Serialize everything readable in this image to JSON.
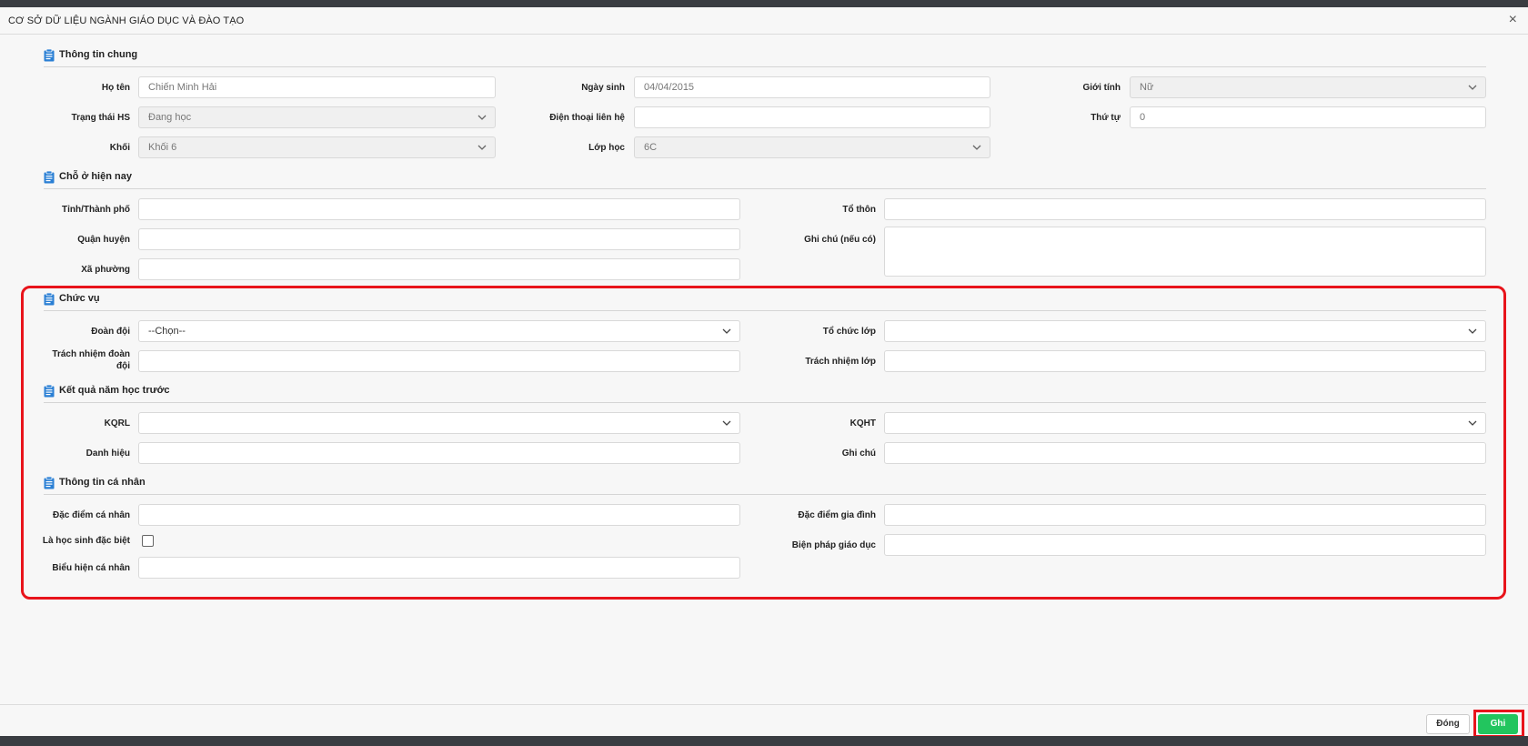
{
  "dialog": {
    "title": "CƠ SỞ DỮ LIỆU NGÀNH GIÁO DỤC VÀ ĐÀO TẠO",
    "close_glyph": "×"
  },
  "sections": {
    "general": "Thông tin chung",
    "residence": "Chỗ ở hiện nay",
    "position": "Chức vụ",
    "prev_result": "Kết quả năm học trước",
    "personal": "Thông tin cá nhân"
  },
  "general": {
    "name_label": "Họ tên",
    "name_value": "Chiến Minh Hải",
    "dob_label": "Ngày sinh",
    "dob_value": "04/04/2015",
    "gender_label": "Giới tính",
    "gender_value": "Nữ",
    "status_label": "Trạng thái HS",
    "status_value": "Đang học",
    "phone_label": "Điện thoại liên hệ",
    "phone_value": "",
    "order_label": "Thứ tự",
    "order_value": "0",
    "grade_label": "Khối",
    "grade_value": "Khối 6",
    "class_label": "Lớp học",
    "class_value": "6C"
  },
  "residence": {
    "province_label": "Tỉnh/Thành phố",
    "hamlet_label": "Tổ thôn",
    "district_label": "Quận huyện",
    "note_label": "Ghi chú (nếu có)",
    "ward_label": "Xã phường"
  },
  "position": {
    "union_label": "Đoàn đội",
    "union_value": "--Chọn--",
    "class_org_label": "Tổ chức lớp",
    "class_org_value": "",
    "union_duty_label_1": "Trách nhiệm đoàn",
    "union_duty_label_2": "đội",
    "class_duty_label": "Trách nhiệm lớp"
  },
  "prev_result": {
    "kqrl_label": "KQRL",
    "kqht_label": "KQHT",
    "title_label": "Danh hiệu",
    "note_label": "Ghi chú"
  },
  "personal": {
    "traits_label": "Đặc điểm cá nhân",
    "family_label": "Đặc điểm gia đình",
    "special_label": "Là học sinh đặc biệt",
    "special_checked": false,
    "edu_measure_label": "Biện pháp giáo dục",
    "expression_label": "Biểu hiện cá nhân"
  },
  "footer": {
    "close_label": "Đóng",
    "save_label": "Ghi"
  },
  "colors": {
    "highlight": "#e8141b",
    "save_button": "#22c55e",
    "section_icon": "#2a7fd4"
  }
}
